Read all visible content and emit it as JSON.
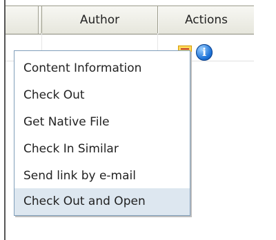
{
  "table": {
    "columns": [
      {
        "label": ""
      },
      {
        "label": "Author"
      },
      {
        "label": "Actions"
      }
    ]
  },
  "icons": {
    "list": "document-list-icon",
    "info": "info-icon",
    "info_glyph": "i"
  },
  "context_menu": {
    "items": [
      {
        "label": "Content Information"
      },
      {
        "label": "Check Out"
      },
      {
        "label": "Get Native File"
      },
      {
        "label": "Check In Similar"
      },
      {
        "label": "Send link by e-mail"
      },
      {
        "label": "Check Out and Open",
        "highlighted": true
      }
    ]
  },
  "colors": {
    "header_bg": "#e6e6dc",
    "menu_border": "#7f9db9",
    "menu_highlight": "#dde7f0",
    "info_blue": "#1f74d8"
  }
}
